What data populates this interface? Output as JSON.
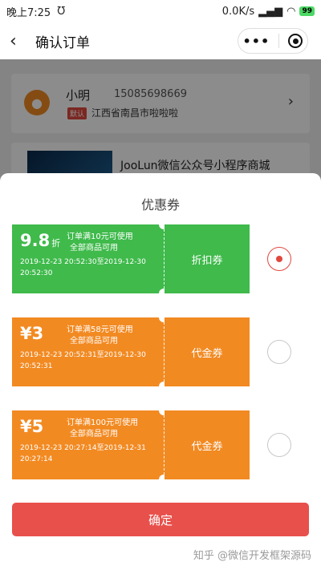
{
  "status_bar": {
    "time": "晚上7:25",
    "speed": "0.0K/s",
    "battery": "99"
  },
  "nav": {
    "title": "确认订单",
    "more": "•••"
  },
  "address": {
    "name": "小明",
    "phone": "15085698669",
    "tag": "默认",
    "detail": "江西省南昌市啦啦啦"
  },
  "goods": {
    "name": "JooLun微信公众号小程序商城"
  },
  "sheet": {
    "title": "优惠券",
    "coupons": [
      {
        "value": "9.8",
        "unit": "折",
        "condition": "订单满10元可使用",
        "scope": "全部商品可用",
        "date": "2019-12-23 20:52:30至2019-12-30 20:52:30",
        "type": "折扣券",
        "color": "#3fba4b",
        "selected": true
      },
      {
        "value": "¥3",
        "unit": "",
        "condition": "订单满58元可使用",
        "scope": "全部商品可用",
        "date": "2019-12-23 20:52:31至2019-12-30 20:52:31",
        "type": "代金券",
        "color": "#f28a22",
        "selected": false
      },
      {
        "value": "¥5",
        "unit": "",
        "condition": "订单满100元可使用",
        "scope": "全部商品可用",
        "date": "2019-12-23 20:27:14至2019-12-31 20:27:14",
        "type": "代金券",
        "color": "#f28a22",
        "selected": false
      }
    ],
    "confirm_label": "确定"
  },
  "watermark": "知乎 @微信开发框架源码"
}
